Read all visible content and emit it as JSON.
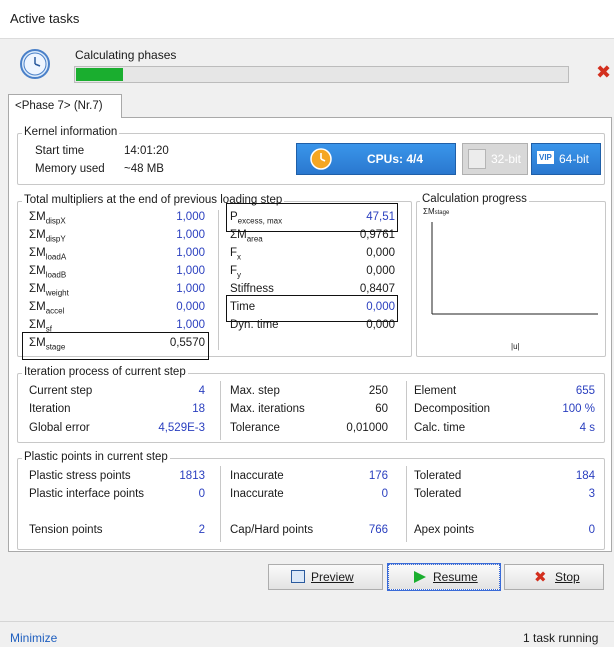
{
  "window": {
    "title": "Active tasks"
  },
  "task": {
    "status": "Calculating phases",
    "progress_percent": 9.5,
    "cancel_icon": "close-x-red"
  },
  "tab": {
    "label": "<Phase 7> (Nr.7)"
  },
  "kernel": {
    "group_title": "Kernel information",
    "start_time_label": "Start time",
    "start_time_value": "14:01:20",
    "memory_label": "Memory used",
    "memory_value": "~48 MB",
    "cpus_label": "CPUs: 4/4",
    "bit32_label": "32-bit",
    "bit64_label": "64-bit",
    "vip_badge": "VIP"
  },
  "multipliers": {
    "group_title": "Total multipliers at the end of previous loading step",
    "left": [
      {
        "main": "ΣM",
        "sub": "dispX",
        "value": "1,000"
      },
      {
        "main": "ΣM",
        "sub": "dispY",
        "value": "1,000"
      },
      {
        "main": "ΣM",
        "sub": "loadA",
        "value": "1,000"
      },
      {
        "main": "ΣM",
        "sub": "loadB",
        "value": "1,000"
      },
      {
        "main": "ΣM",
        "sub": "weight",
        "value": "1,000"
      },
      {
        "main": "ΣM",
        "sub": "accel",
        "value": "0,000"
      },
      {
        "main": "ΣM",
        "sub": "sf",
        "value": "1,000"
      },
      {
        "main": "ΣM",
        "sub": "stage",
        "value": "0,5570"
      }
    ],
    "right": [
      {
        "main": "P",
        "sub": "excess, max",
        "value": "47,51"
      },
      {
        "main": "ΣM",
        "sub": "area",
        "value": "0,9761"
      },
      {
        "main": "F",
        "sub": "x",
        "value": "0,000"
      },
      {
        "main": "F",
        "sub": "y",
        "value": "0,000"
      },
      {
        "main": "Stiffness",
        "sub": "",
        "value": "0,8407"
      },
      {
        "main": "Time",
        "sub": "",
        "value": "0,000"
      },
      {
        "main": "Dyn. time",
        "sub": "",
        "value": "0,000"
      }
    ]
  },
  "calc_progress": {
    "group_title": "Calculation progress",
    "y_label_main": "ΣM",
    "y_label_sub": "stage",
    "x_label": "|u|"
  },
  "iteration": {
    "group_title": "Iteration process of current step",
    "rows": [
      [
        {
          "label": "Current step",
          "value": "4"
        },
        {
          "label": "Max. step",
          "value": "250"
        },
        {
          "label": "Element",
          "value": "655"
        }
      ],
      [
        {
          "label": "Iteration",
          "value": "18"
        },
        {
          "label": "Max. iterations",
          "value": "60"
        },
        {
          "label": "Decomposition",
          "value": "100 %"
        }
      ],
      [
        {
          "label": "Global error",
          "value": "4,529E-3"
        },
        {
          "label": "Tolerance",
          "value": "0,01000"
        },
        {
          "label": "Calc. time",
          "value": "4 s"
        }
      ]
    ]
  },
  "plastic": {
    "group_title": "Plastic points in current step",
    "rows": [
      [
        {
          "label": "Plastic stress points",
          "value": "1813"
        },
        {
          "label": "Inaccurate",
          "value": "176"
        },
        {
          "label": "Tolerated",
          "value": "184"
        }
      ],
      [
        {
          "label": "Plastic interface points",
          "value": "0"
        },
        {
          "label": "Inaccurate",
          "value": "0"
        },
        {
          "label": "Tolerated",
          "value": "3"
        }
      ],
      [
        {
          "label": "Tension points",
          "value": "2"
        },
        {
          "label": "Cap/Hard points",
          "value": "766"
        },
        {
          "label": "Apex points",
          "value": "0"
        }
      ]
    ]
  },
  "buttons": {
    "preview": "Preview",
    "resume": "Resume",
    "stop": "Stop"
  },
  "status": {
    "minimize": "Minimize",
    "running": "1 task running"
  },
  "colors": {
    "progress": "#1aae2f",
    "value_blue": "#2a3fbf",
    "cpu_button": "#2a78cf",
    "stop_icon": "#d32f1e"
  }
}
